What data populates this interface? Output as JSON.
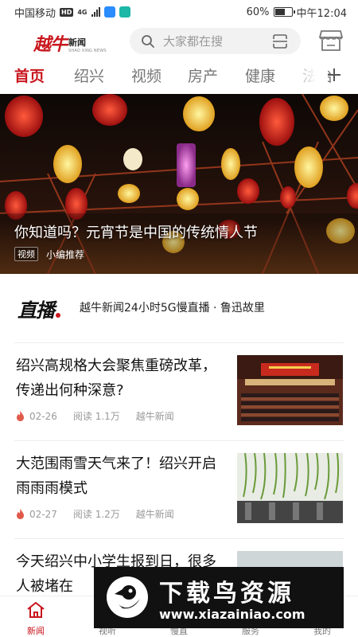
{
  "status_bar": {
    "carrier": "中国移动",
    "hd": "HD",
    "network": "4G",
    "battery": "60%",
    "battery_level": 0.6,
    "time": "中午12:04"
  },
  "header": {
    "logo_main": "越牛",
    "logo_sub": "新闻",
    "logo_en": "SHAO XING NEWS",
    "search_placeholder": "大家都在搜"
  },
  "tabs": [
    "首页",
    "绍兴",
    "视频",
    "房产",
    "健康",
    "法治"
  ],
  "active_tab": 0,
  "hero": {
    "title": "你知道吗？元宵节是中国的传统情人节",
    "tag": "视频",
    "source": "小编推荐"
  },
  "live": {
    "logo": "直播",
    "text": "越牛新闻24小时5G慢直播 · 鲁迅故里"
  },
  "news": [
    {
      "title": "绍兴高规格大会聚焦重磅改革，传递出何种深意?",
      "date": "02-26",
      "reads": "阅读 1.1万",
      "source": "越牛新闻"
    },
    {
      "title": "大范围雨雪天气来了！绍兴开启雨雨雨模式",
      "date": "02-27",
      "reads": "阅读 1.2万",
      "source": "越牛新闻"
    },
    {
      "title": "今天绍兴中小学生报到日，很多人被堵在"
    }
  ],
  "bottom_nav": [
    {
      "label": "新闻",
      "icon": "home-icon"
    },
    {
      "label": "视听",
      "icon": "play-icon"
    },
    {
      "label": "慢直",
      "icon": "live-icon"
    },
    {
      "label": "服务",
      "icon": "service-icon"
    },
    {
      "label": "我的",
      "icon": "user-icon"
    }
  ],
  "watermark": {
    "main": "下载鸟资源",
    "url": "www.xiazainiao.com"
  },
  "colors": {
    "accent": "#c8161d",
    "text": "#111111",
    "meta": "#999999"
  }
}
